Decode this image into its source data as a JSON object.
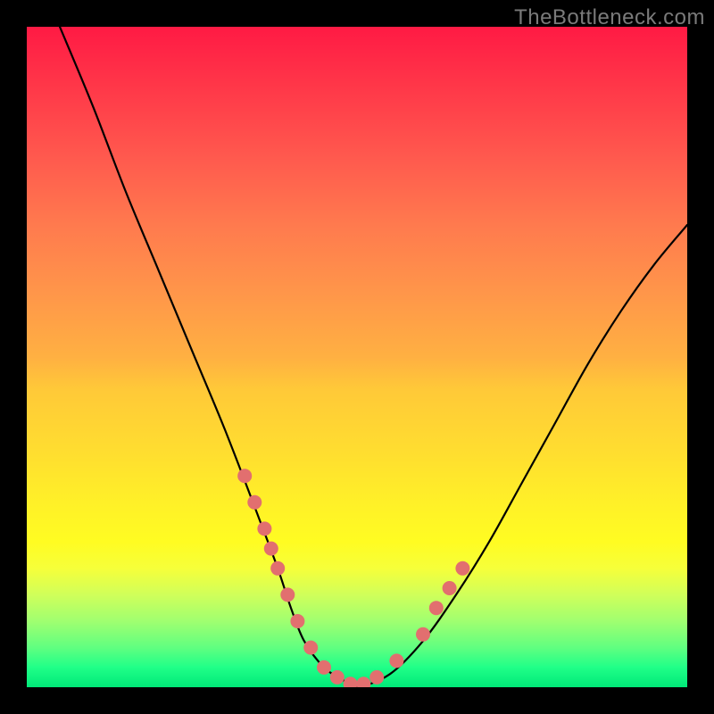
{
  "watermark": "TheBottleneck.com",
  "chart_data": {
    "type": "line",
    "title": "",
    "xlabel": "",
    "ylabel": "",
    "xlim": [
      0,
      100
    ],
    "ylim": [
      0,
      100
    ],
    "series": [
      {
        "name": "curve",
        "x": [
          5,
          10,
          15,
          20,
          25,
          30,
          35,
          38,
          40,
          42,
          45,
          48,
          50,
          55,
          60,
          65,
          70,
          75,
          80,
          85,
          90,
          95,
          100
        ],
        "y": [
          100,
          88,
          75,
          63,
          51,
          39,
          26,
          18,
          12,
          7,
          3,
          1,
          0,
          2,
          7,
          14,
          22,
          31,
          40,
          49,
          57,
          64,
          70
        ]
      }
    ],
    "markers": {
      "name": "highlight-dots",
      "color": "#e26f6f",
      "points_xy": [
        [
          33,
          32
        ],
        [
          34.5,
          28
        ],
        [
          36,
          24
        ],
        [
          37,
          21
        ],
        [
          38,
          18
        ],
        [
          39.5,
          14
        ],
        [
          41,
          10
        ],
        [
          43,
          6
        ],
        [
          45,
          3
        ],
        [
          47,
          1.5
        ],
        [
          49,
          0.5
        ],
        [
          51,
          0.5
        ],
        [
          53,
          1.5
        ],
        [
          56,
          4
        ],
        [
          60,
          8
        ],
        [
          62,
          12
        ],
        [
          64,
          15
        ],
        [
          66,
          18
        ]
      ]
    },
    "gradient_stops": [
      {
        "pos": 0.0,
        "color": "#ff1a44"
      },
      {
        "pos": 0.5,
        "color": "#ffb042"
      },
      {
        "pos": 0.78,
        "color": "#fffc22"
      },
      {
        "pos": 1.0,
        "color": "#00e878"
      }
    ]
  }
}
